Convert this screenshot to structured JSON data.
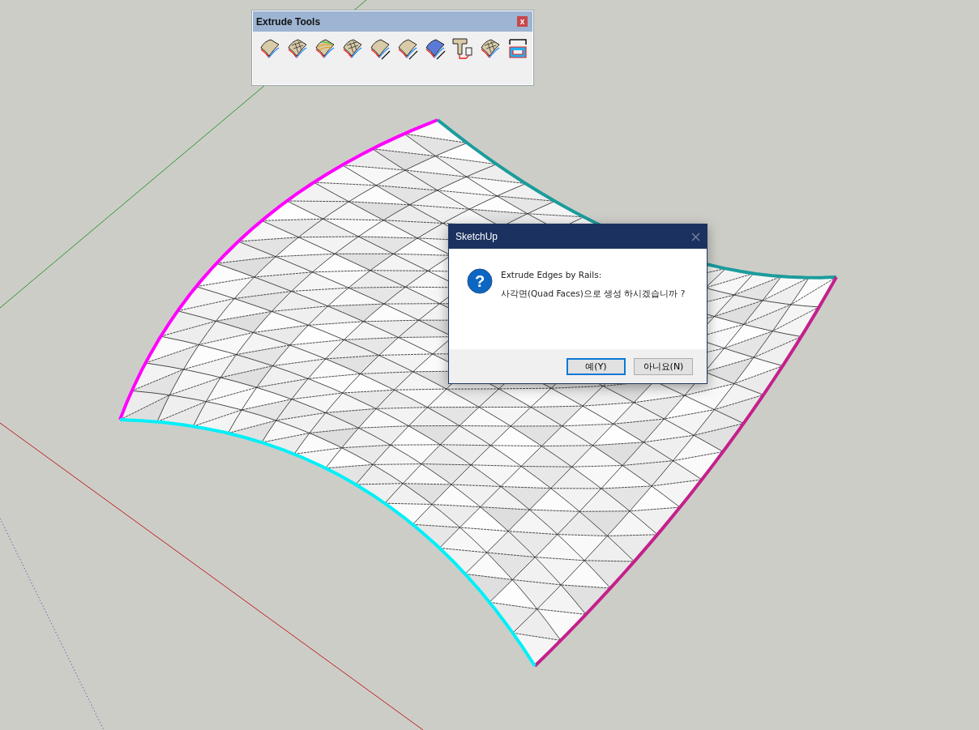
{
  "toolbar": {
    "title": "Extrude Tools",
    "close_label": "x"
  },
  "dialog": {
    "title": "SketchUp",
    "icon_glyph": "?",
    "heading": "Extrude Edges by Rails:",
    "message": "사각면(Quad Faces)으로 생성 하시겠습니까 ?",
    "buttons": [
      {
        "label": "예(Y)",
        "selected": true
      },
      {
        "label": "아니요(N)",
        "selected": false
      }
    ]
  }
}
